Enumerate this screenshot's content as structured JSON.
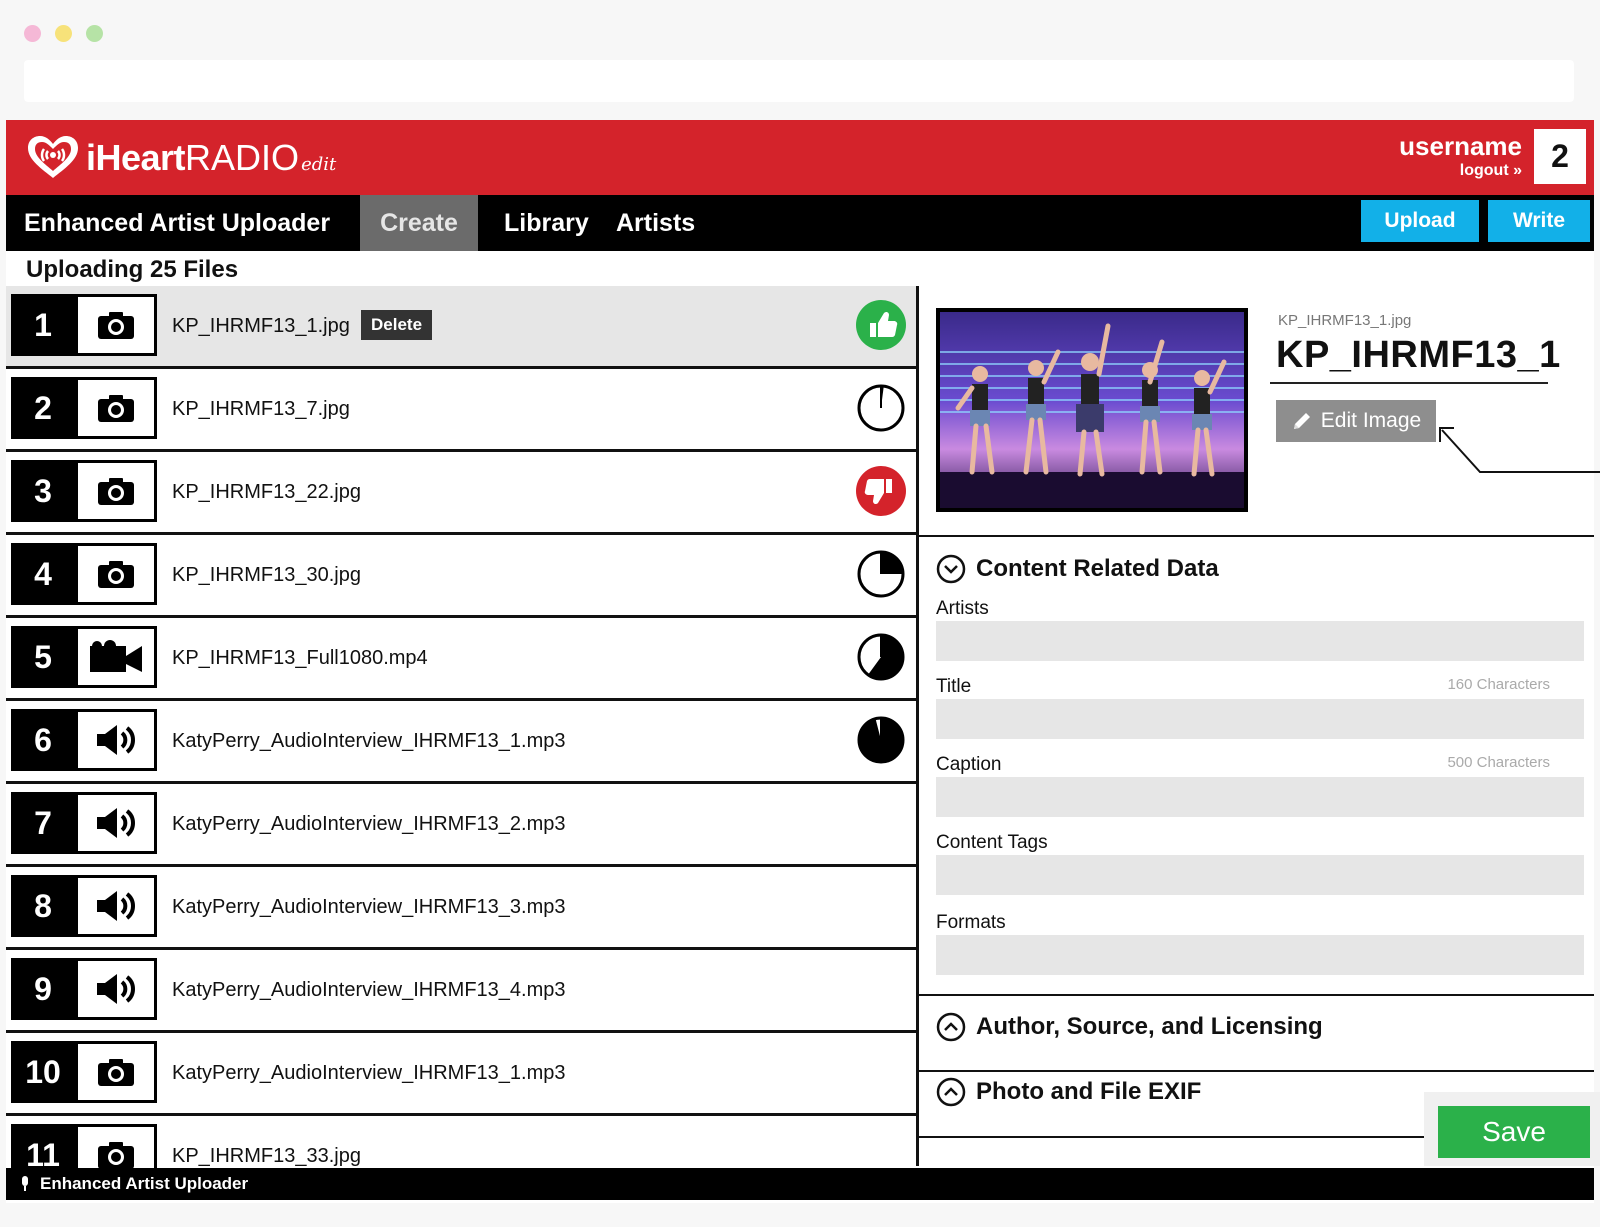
{
  "browser": {
    "dot_colors": [
      "#f5b8d6",
      "#f7e27a",
      "#b6e3a6"
    ]
  },
  "brand": {
    "iheart": "iHeart",
    "radio": "RADIO",
    "edit": "edit",
    "primary_color": "#d4232b",
    "accent_color": "#12b0e8",
    "success_color": "#2bb14a",
    "danger_color": "#d4232b"
  },
  "user": {
    "username": "username",
    "logout": "logout »",
    "notification_count": "2"
  },
  "nav": {
    "app_name": "Enhanced Artist Uploader",
    "create": "Create",
    "library": "Library",
    "artists": "Artists",
    "upload": "Upload",
    "write": "Write",
    "active": "Create"
  },
  "subheader": "Uploading 25 Files",
  "files": [
    {
      "num": "1",
      "type": "camera-icon",
      "name": "KP_IHRMF13_1.jpg",
      "status": "approved",
      "selected": true,
      "delete_label": "Delete"
    },
    {
      "num": "2",
      "type": "camera-icon",
      "name": "KP_IHRMF13_7.jpg",
      "status": "progress",
      "progress": 0.02
    },
    {
      "num": "3",
      "type": "camera-icon",
      "name": "KP_IHRMF13_22.jpg",
      "status": "rejected"
    },
    {
      "num": "4",
      "type": "camera-icon",
      "name": "KP_IHRMF13_30.jpg",
      "status": "progress",
      "progress": 0.25
    },
    {
      "num": "5",
      "type": "video-icon",
      "name": "KP_IHRMF13_Full1080.mp4",
      "status": "progress",
      "progress": 0.6
    },
    {
      "num": "6",
      "type": "speaker-icon",
      "name": "KatyPerry_AudioInterview_IHRMF13_1.mp3",
      "status": "progress",
      "progress": 0.96
    },
    {
      "num": "7",
      "type": "speaker-icon",
      "name": "KatyPerry_AudioInterview_IHRMF13_2.mp3",
      "status": "none"
    },
    {
      "num": "8",
      "type": "speaker-icon",
      "name": "KatyPerry_AudioInterview_IHRMF13_3.mp3",
      "status": "none"
    },
    {
      "num": "9",
      "type": "speaker-icon",
      "name": "KatyPerry_AudioInterview_IHRMF13_4.mp3",
      "status": "none"
    },
    {
      "num": "10",
      "type": "camera-icon",
      "name": "KatyPerry_AudioInterview_IHRMF13_1.mp3",
      "status": "none"
    },
    {
      "num": "11",
      "type": "camera-icon",
      "name": "KP_IHRMF13_33.jpg",
      "status": "none"
    }
  ],
  "detail": {
    "filename_small": "KP_IHRMF13_1.jpg",
    "filename_big": "KP_IHRMF13_1",
    "edit_image": "Edit Image",
    "content_section": "Content Related Data",
    "fields": {
      "artists": "Artists",
      "title": "Title",
      "title_hint": "160 Characters",
      "caption": "Caption",
      "caption_hint": "500 Characters",
      "content_tags": "Content Tags",
      "formats": "Formats"
    },
    "author_section": "Author, Source, and Licensing",
    "exif_section": "Photo and File EXIF",
    "save": "Save"
  },
  "footer": {
    "label": "Enhanced Artist Uploader"
  }
}
